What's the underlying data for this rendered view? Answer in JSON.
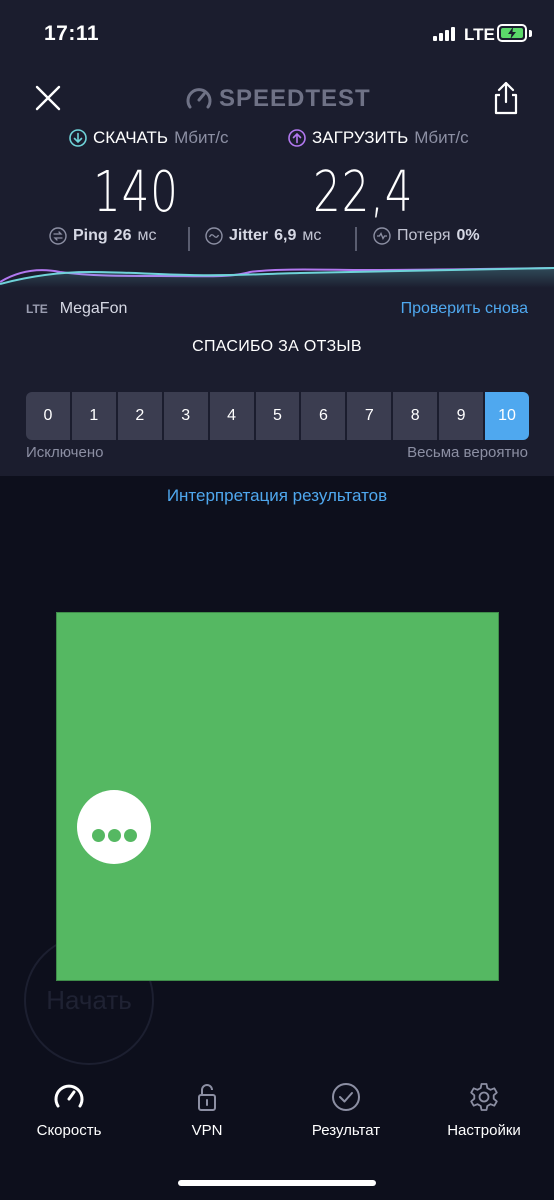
{
  "status_bar": {
    "time": "17:11",
    "network": "LTE"
  },
  "header": {
    "logo_text": "SPEEDTEST"
  },
  "download": {
    "label": "СКАЧАТЬ",
    "unit": "Мбит/с",
    "value": "140",
    "color": "#6fd3d9"
  },
  "upload": {
    "label": "ЗАГРУЗИТЬ",
    "unit": "Мбит/с",
    "value": "22,4",
    "color": "#b278f0"
  },
  "stats": {
    "ping_label": "Ping",
    "ping_value": "26",
    "ping_unit": "мс",
    "jitter_label": "Jitter",
    "jitter_value": "6,9",
    "jitter_unit": "мс",
    "loss_label": "Потеря",
    "loss_value": "0%"
  },
  "connection": {
    "type": "LTE",
    "carrier": "MegaFon",
    "retest_label": "Проверить снова"
  },
  "feedback": {
    "title": "СПАСИБО ЗА ОТЗЫВ",
    "options": [
      "0",
      "1",
      "2",
      "3",
      "4",
      "5",
      "6",
      "7",
      "8",
      "9",
      "10"
    ],
    "selected": "10",
    "label_left": "Исключено",
    "label_right": "Весьма вероятно"
  },
  "interpretation_link": "Интерпретация результатов",
  "start_button": "Начать",
  "tabs": [
    {
      "label": "Скорость",
      "icon": "speedometer-icon"
    },
    {
      "label": "VPN",
      "icon": "lock-icon"
    },
    {
      "label": "Результат",
      "icon": "checkmark-icon"
    },
    {
      "label": "Настройки",
      "icon": "gear-icon"
    }
  ],
  "colors": {
    "accent": "#4fa8ef",
    "ad_green": "#55b862",
    "panel": "#1b1d2e",
    "background": "#0d0f1c"
  }
}
